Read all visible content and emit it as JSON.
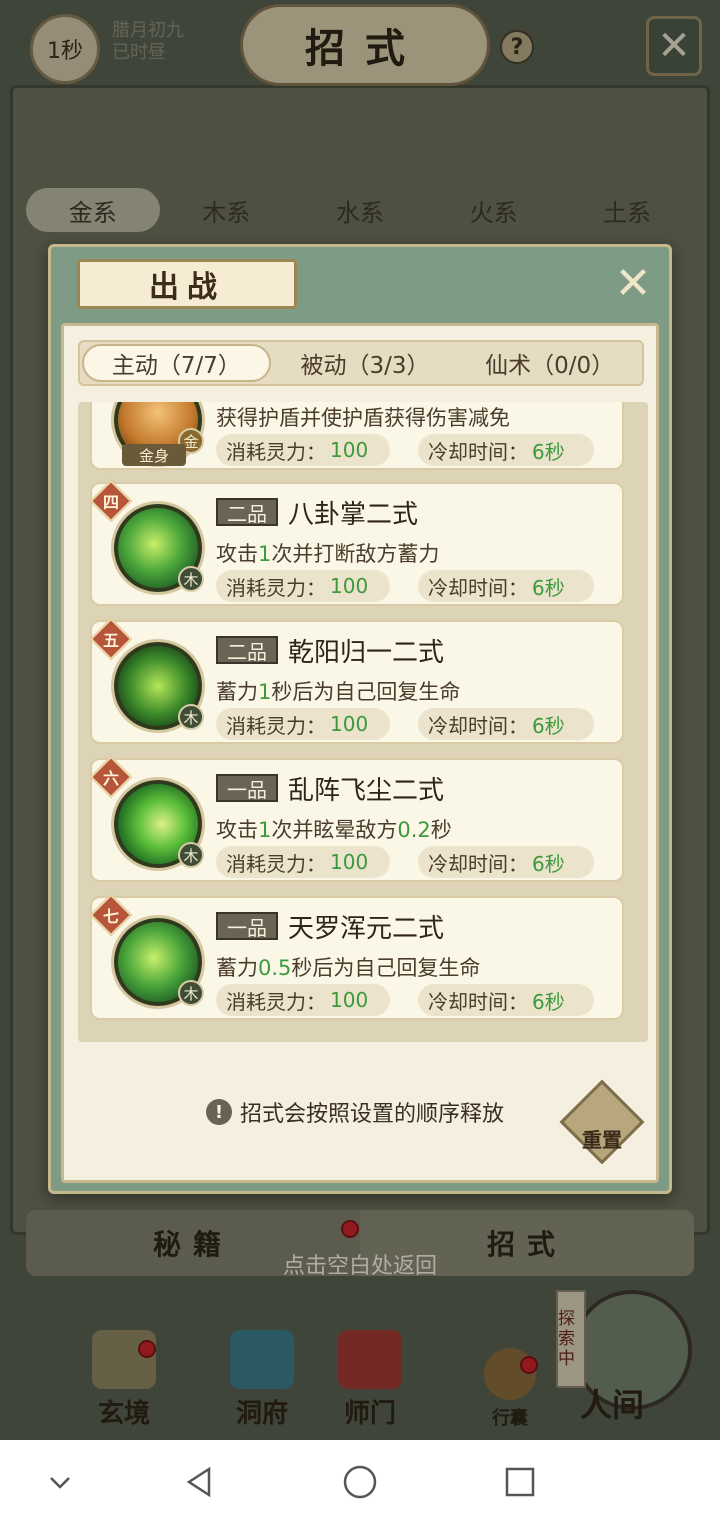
{
  "header": {
    "timer": "1秒",
    "date_line1": "腊月初九",
    "date_line2": "已时昼",
    "title": "招式",
    "help_label": "?"
  },
  "element_tabs": [
    "金系",
    "木系",
    "水系",
    "火系",
    "土系"
  ],
  "modal": {
    "title": "出战",
    "tabs": [
      "主动（7/7）",
      "被动（3/3）",
      "仙术（0/0）"
    ],
    "partial_card": {
      "badge_text": "金身",
      "elem": "金",
      "desc": "获得护盾并使护盾获得伤害减免",
      "cost_label": "消耗灵力：",
      "cost_value": "100",
      "cd_label": "冷却时间：",
      "cd_value": "6秒"
    },
    "skills": [
      {
        "rank": "四",
        "grade": "二品",
        "name": "八卦掌二式",
        "desc_pre": "攻击",
        "desc_hl1": "1",
        "desc_mid": "次并打断敌方蓄力",
        "desc_hl2": "",
        "desc_post": "",
        "elem": "木",
        "cost_label": "消耗灵力：",
        "cost_value": "100",
        "cd_label": "冷却时间：",
        "cd_value": "6秒"
      },
      {
        "rank": "五",
        "grade": "二品",
        "name": "乾阳归一二式",
        "desc_pre": "蓄力",
        "desc_hl1": "1",
        "desc_mid": "秒后为自己回复生命",
        "desc_hl2": "",
        "desc_post": "",
        "elem": "木",
        "cost_label": "消耗灵力：",
        "cost_value": "100",
        "cd_label": "冷却时间：",
        "cd_value": "6秒"
      },
      {
        "rank": "六",
        "grade": "一品",
        "name": "乱阵飞尘二式",
        "desc_pre": "攻击",
        "desc_hl1": "1",
        "desc_mid": "次并眩晕敌方",
        "desc_hl2": "0.2",
        "desc_post": "秒",
        "elem": "木",
        "cost_label": "消耗灵力：",
        "cost_value": "100",
        "cd_label": "冷却时间：",
        "cd_value": "6秒"
      },
      {
        "rank": "七",
        "grade": "一品",
        "name": "天罗浑元二式",
        "desc_pre": "蓄力",
        "desc_hl1": "0.5",
        "desc_mid": "秒后为自己回复生命",
        "desc_hl2": "",
        "desc_post": "",
        "elem": "木",
        "cost_label": "消耗灵力：",
        "cost_value": "100",
        "cd_label": "冷却时间：",
        "cd_value": "6秒"
      }
    ],
    "note": "招式会按照设置的顺序释放",
    "note_icon": "!",
    "reset_label": "重置"
  },
  "bottom_tabs": {
    "left": "秘籍",
    "right": "招式",
    "return_hint": "点击空白处返回"
  },
  "nav": {
    "items": [
      "玄境",
      "洞府",
      "师门",
      "行囊",
      "人间"
    ],
    "explore_badge": "探索中"
  },
  "colors": {
    "accent_green": "#3c9a3c",
    "rank_red": "#b6553a",
    "notification_red": "#c8242a"
  }
}
